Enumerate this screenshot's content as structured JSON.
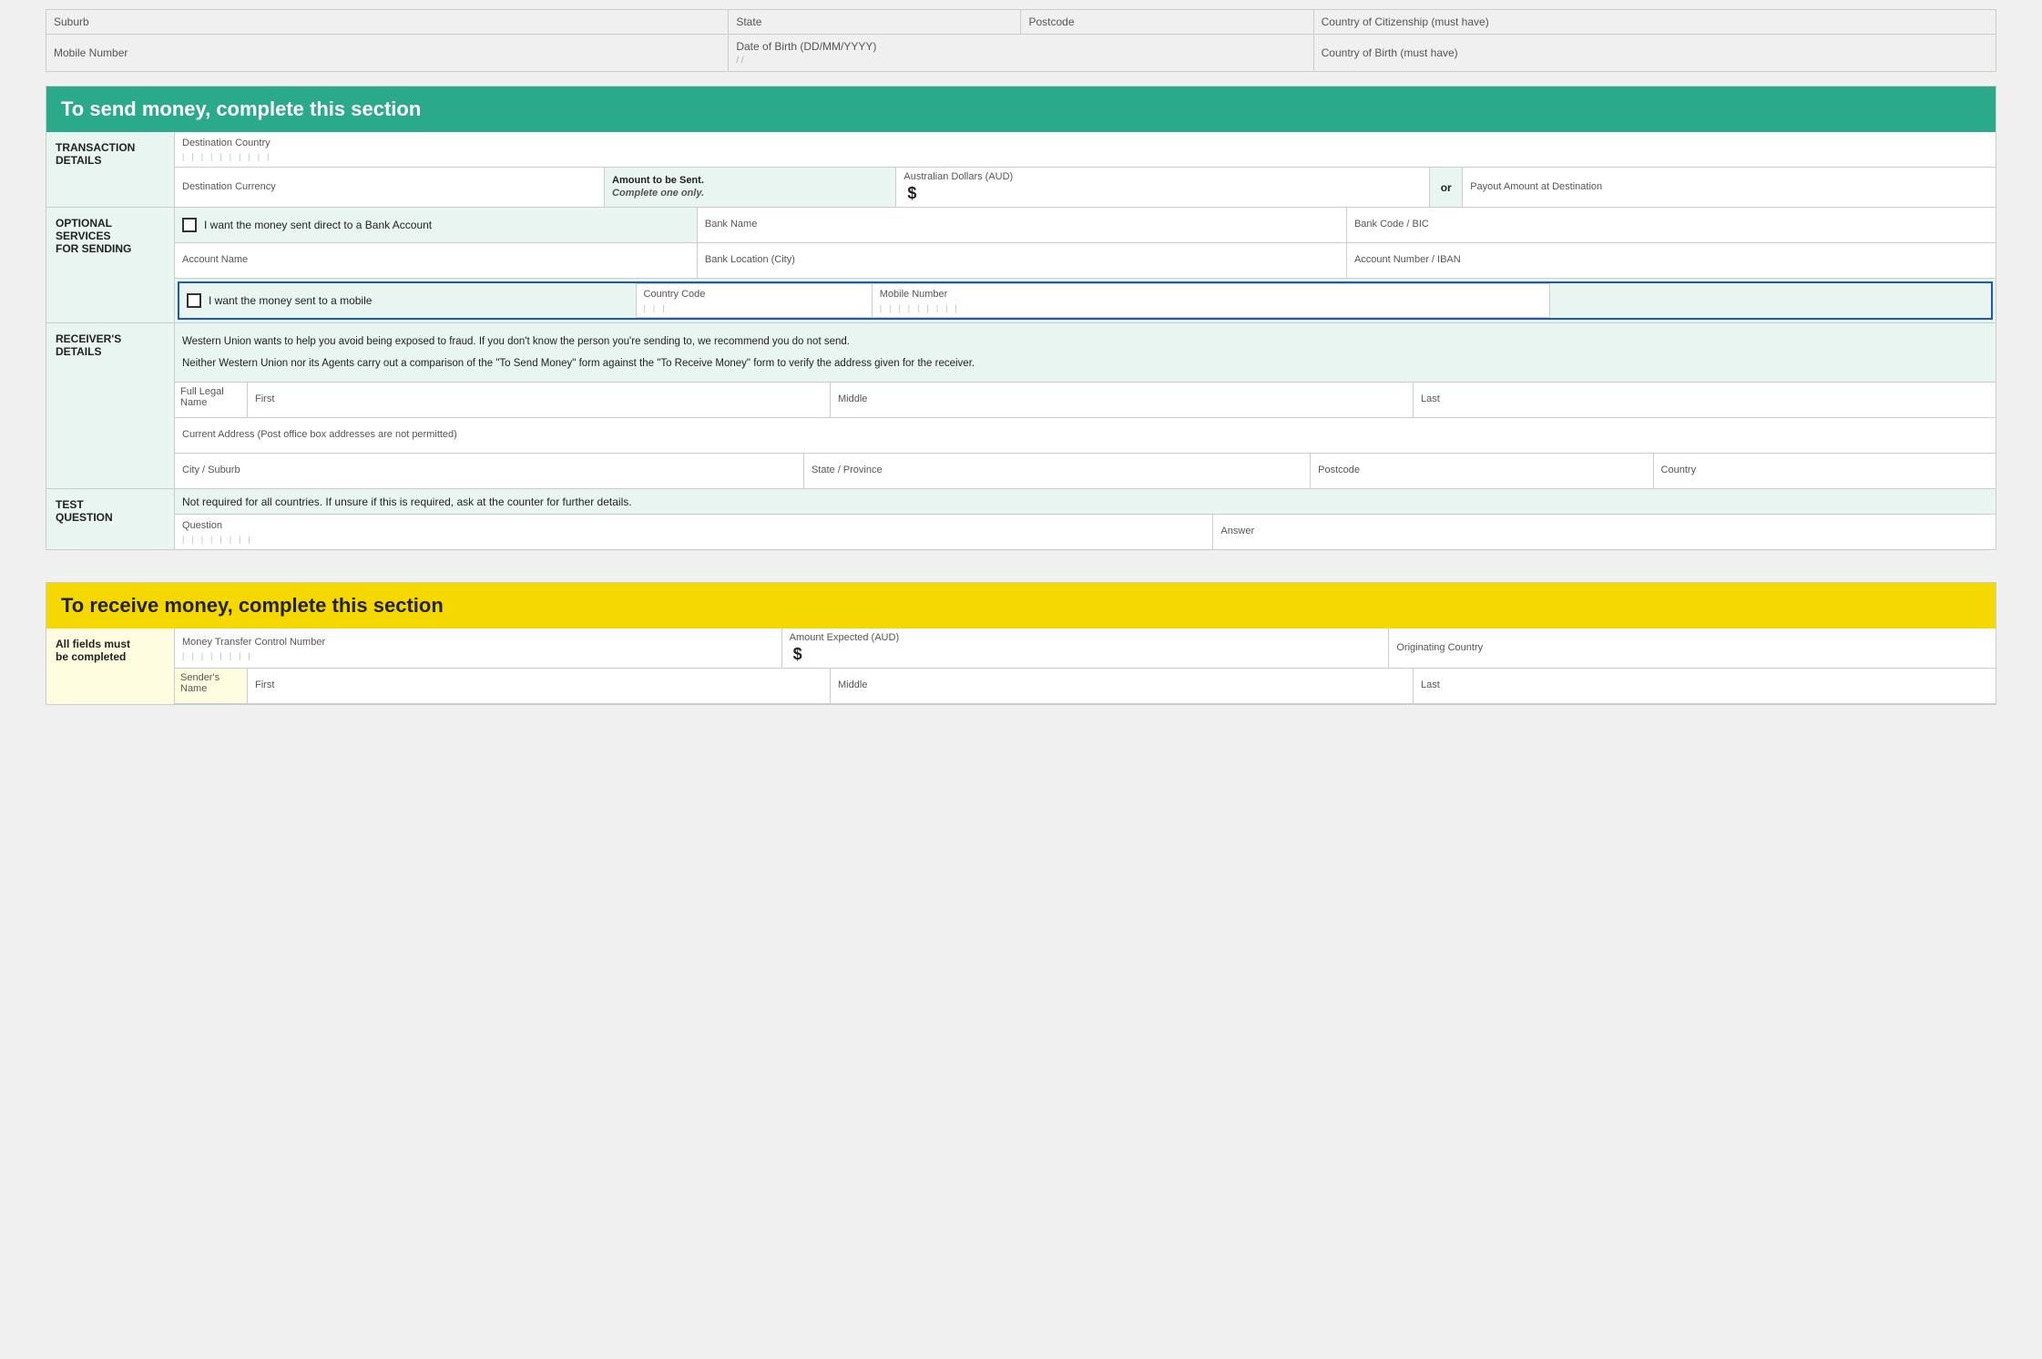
{
  "top": {
    "row1": [
      "Suburb",
      "State",
      "Postcode",
      "Country of Citizenship (must have)"
    ],
    "row2_label": "Mobile Number",
    "row2_col2": "Date of Birth (DD/MM/YYYY)",
    "row2_col2_sub": "/         /",
    "row2_col3": "Country of Birth (must have)"
  },
  "send_section": {
    "header": "To send money, complete this section",
    "transaction_label": "TRANSACTION\nDETAILS",
    "destination_country_label": "Destination Country",
    "destination_currency_label": "Destination Currency",
    "amount_to_be_sent_label": "Amount to be Sent.",
    "complete_one_only": "Complete one only.",
    "aud_label": "Australian Dollars (AUD)",
    "dollar_sign": "$",
    "or_label": "or",
    "payout_label": "Payout Amount at Destination",
    "optional_label": "OPTIONAL\nSERVICES\nFOR SENDING",
    "checkbox1_label": "I want the money sent direct to a Bank Account",
    "bank_name_label": "Bank Name",
    "bank_code_label": "Bank Code / BIC",
    "account_name_label": "Account Name",
    "bank_location_label": "Bank Location (City)",
    "account_number_label": "Account Number / IBAN",
    "checkbox2_label": "I want the money sent to a mobile",
    "country_code_label": "Country Code",
    "mobile_number_label": "Mobile Number",
    "receivers_label": "RECEIVER'S\nDETAILS",
    "receivers_warning1": "Western Union wants to help you avoid being exposed to fraud. If you don't know the person you're sending to, we recommend you do not send.",
    "receivers_warning2": "Neither Western Union nor its Agents carry out a comparison of the \"To Send Money\" form against the \"To Receive Money\" form to verify the address given for the receiver.",
    "full_legal_name_label": "Full Legal Name",
    "first_label": "First",
    "middle_label": "Middle",
    "last_label": "Last",
    "current_address_label": "Current Address  (Post office box addresses are not permitted)",
    "city_suburb_label": "City / Suburb",
    "state_province_label": "State / Province",
    "postcode_label": "Postcode",
    "country_label": "Country",
    "test_question_label": "TEST\nQUESTION",
    "test_question_note": "Not required for all countries. If unsure if this is required, ask at the counter for further details.",
    "question_label": "Question",
    "answer_label": "Answer"
  },
  "receive_section": {
    "header": "To receive money, complete this section",
    "all_fields_label": "All fields must\nbe completed",
    "mtcn_label": "Money Transfer Control Number",
    "amount_expected_label": "Amount Expected (AUD)",
    "dollar_sign": "$",
    "originating_country_label": "Originating Country",
    "senders_name_label": "Sender's Name",
    "first_label": "First",
    "middle_label": "Middle",
    "last_label": "Last"
  }
}
